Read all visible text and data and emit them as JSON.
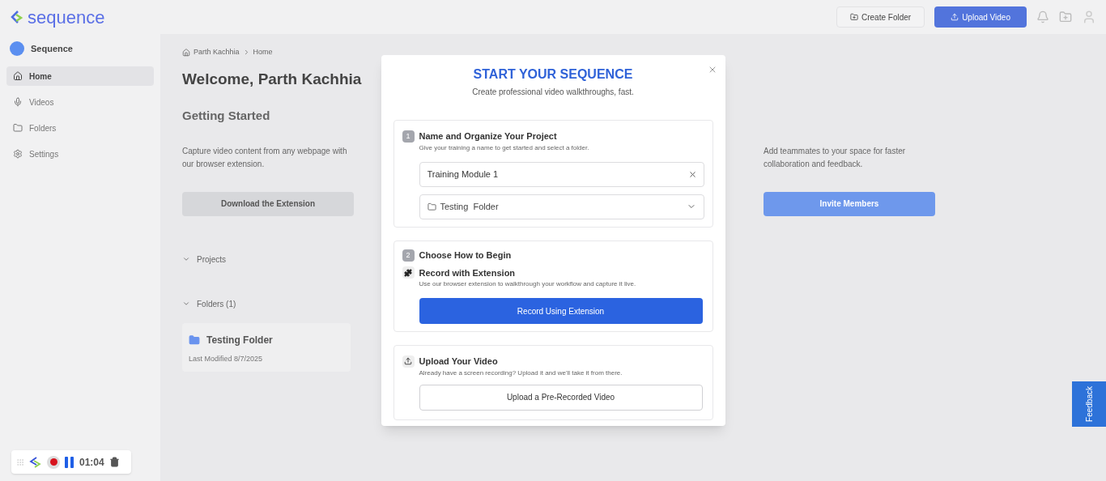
{
  "header": {
    "logo": "sequence",
    "buttons": [
      {
        "label": "Create Folder",
        "kind": "outline"
      },
      {
        "label": "Upload Video",
        "kind": "primary"
      }
    ]
  },
  "sidebar": {
    "workspace": "Sequence",
    "items": [
      {
        "label": "Home",
        "selected": true
      },
      {
        "label": "Videos",
        "selected": false
      },
      {
        "label": "Folders",
        "selected": false
      },
      {
        "label": "Settings",
        "selected": false
      }
    ]
  },
  "main": {
    "breadcrumb": [
      "Parth Kachhia",
      "Home"
    ],
    "title": "Welcome, Parth Kachhia",
    "section_title": "Getting Started",
    "cards": [
      {
        "description": "Capture video content from any webpage with our browser extension.",
        "button": "Download the Extension",
        "kind": "muted"
      },
      {
        "description": "Add teammates to your space for faster collaboration and feedback.",
        "button": "Invite Members",
        "kind": "primary"
      }
    ],
    "projects_label": "Projects",
    "folders_label": "Folders (1)",
    "folders": [
      {
        "name": "Testing Folder",
        "modified": "Last Modified 8/7/2025"
      }
    ]
  },
  "modal": {
    "title": "START YOUR SEQUENCE",
    "subtitle": "Create professional video walkthroughs, fast.",
    "step1": {
      "number": "1",
      "title": "Name and Organize Your Project",
      "hint": "Give your training a name to get started and select a folder.",
      "name_value": "Training Module 1",
      "folder_value": "Testing  Folder"
    },
    "step2": {
      "number": "2",
      "title": "Choose How to Begin",
      "option_title": "Record with Extension",
      "option_hint": "Use our browser extension to walkthrough your workflow and capture it live.",
      "button": "Record Using Extension"
    },
    "step3": {
      "title": "Upload Your Video",
      "hint": "Already have a screen recording? Upload it and we'll take it from there.",
      "button": "Upload a Pre-Recorded Video"
    }
  },
  "recorder": {
    "time": "01:04"
  },
  "feedback": "Feedback"
}
